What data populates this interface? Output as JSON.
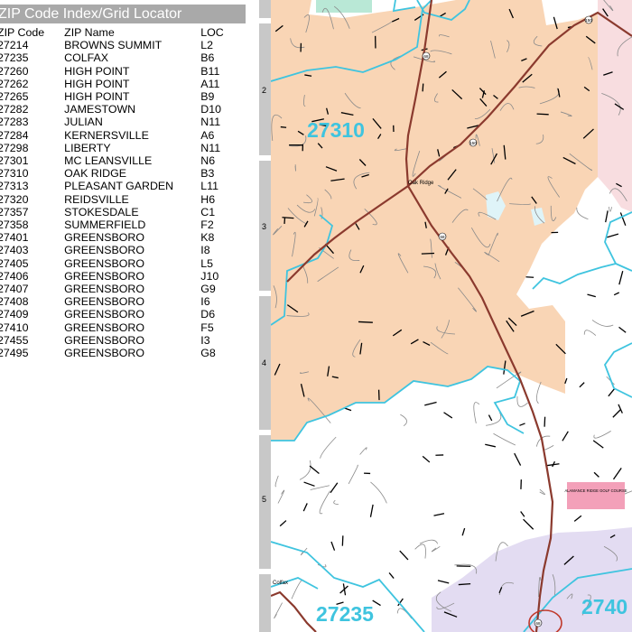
{
  "index": {
    "title": "ZIP Code Index/Grid Locator",
    "headers": {
      "zip": "ZIP Code",
      "name": "ZIP Name",
      "loc": "LOC"
    },
    "rows": [
      {
        "zip": "27214",
        "name": "BROWNS SUMMIT",
        "loc": "L2"
      },
      {
        "zip": "27235",
        "name": "COLFAX",
        "loc": "B6"
      },
      {
        "zip": "27260",
        "name": "HIGH POINT",
        "loc": "B11"
      },
      {
        "zip": "27262",
        "name": "HIGH POINT",
        "loc": "A11"
      },
      {
        "zip": "27265",
        "name": "HIGH POINT",
        "loc": "B9"
      },
      {
        "zip": "27282",
        "name": "JAMESTOWN",
        "loc": "D10"
      },
      {
        "zip": "27283",
        "name": "JULIAN",
        "loc": "N11"
      },
      {
        "zip": "27284",
        "name": "KERNERSVILLE",
        "loc": "A6"
      },
      {
        "zip": "27298",
        "name": "LIBERTY",
        "loc": "N11"
      },
      {
        "zip": "27301",
        "name": "MC LEANSVILLE",
        "loc": "N6"
      },
      {
        "zip": "27310",
        "name": "OAK RIDGE",
        "loc": "B3"
      },
      {
        "zip": "27313",
        "name": "PLEASANT GARDEN",
        "loc": "L11"
      },
      {
        "zip": "27320",
        "name": "REIDSVILLE",
        "loc": "H6"
      },
      {
        "zip": "27357",
        "name": "STOKESDALE",
        "loc": "C1"
      },
      {
        "zip": "27358",
        "name": "SUMMERFIELD",
        "loc": "F2"
      },
      {
        "zip": "27401",
        "name": "GREENSBORO",
        "loc": "K8"
      },
      {
        "zip": "27403",
        "name": "GREENSBORO",
        "loc": "I8"
      },
      {
        "zip": "27405",
        "name": "GREENSBORO",
        "loc": "L5"
      },
      {
        "zip": "27406",
        "name": "GREENSBORO",
        "loc": "J10"
      },
      {
        "zip": "27407",
        "name": "GREENSBORO",
        "loc": "G9"
      },
      {
        "zip": "27408",
        "name": "GREENSBORO",
        "loc": "I6"
      },
      {
        "zip": "27409",
        "name": "GREENSBORO",
        "loc": "D6"
      },
      {
        "zip": "27410",
        "name": "GREENSBORO",
        "loc": "F5"
      },
      {
        "zip": "27455",
        "name": "GREENSBORO",
        "loc": "I3"
      },
      {
        "zip": "27495",
        "name": "GREENSBORO",
        "loc": "G8"
      }
    ]
  },
  "grid": {
    "rows": [
      "2",
      "3",
      "4",
      "5"
    ]
  },
  "map": {
    "zip_labels": [
      "27310",
      "27235",
      "2740"
    ],
    "places": [
      "Oak Ridge",
      "Colfax"
    ],
    "landmark": "ALAMANCE RIDGE GOLF COURSE",
    "highway_shields": [
      "68",
      "150",
      "68",
      "150",
      "68"
    ],
    "colors": {
      "zip_27310_fill": "#f9d5b5",
      "zip_boundary": "#3fc4df",
      "east_zone_fill": "#f8dde0",
      "south_zone_fill": "#e3dcf2",
      "park_fill": "#b9e8d6",
      "highway": "#8b3a2e",
      "landmark_fill": "#f3a0b9"
    }
  }
}
